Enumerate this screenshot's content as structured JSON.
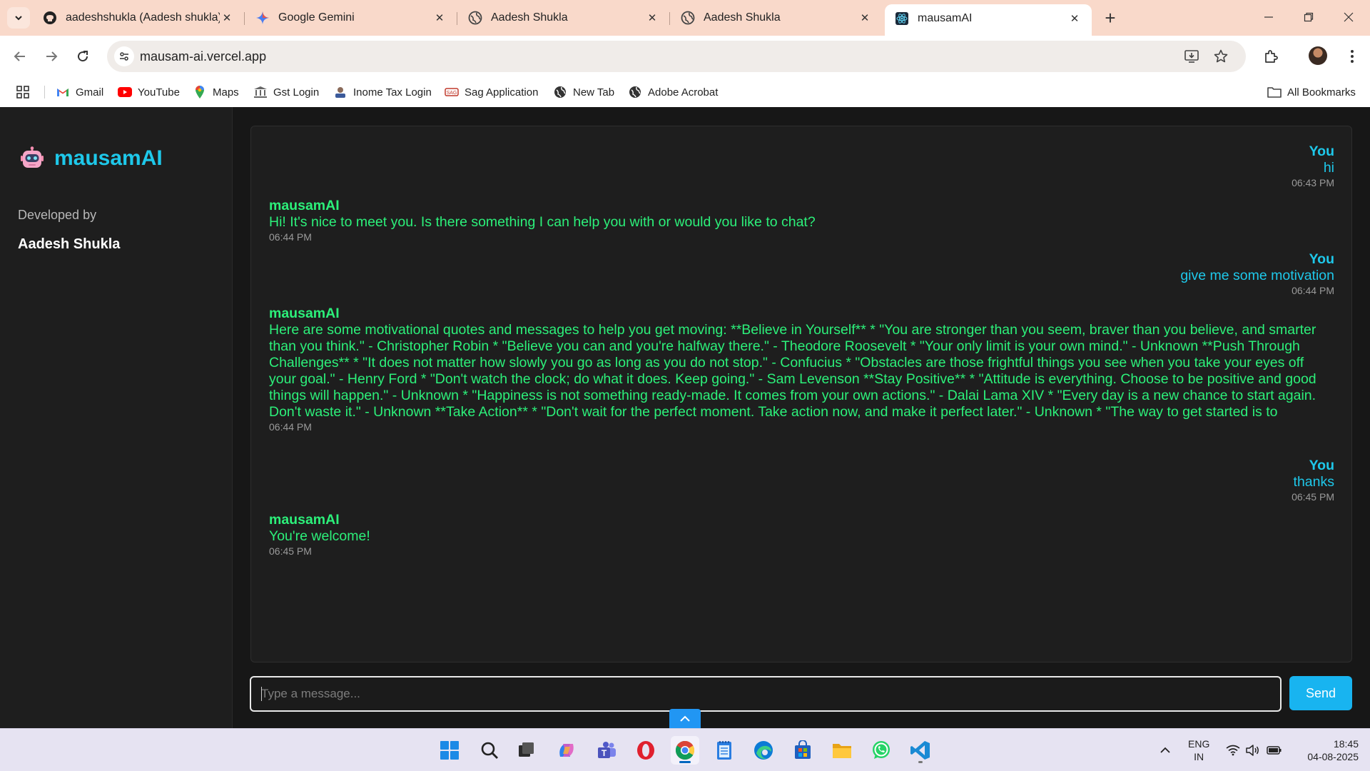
{
  "browser": {
    "tabs": [
      {
        "title": "aadeshshukla (Aadesh shukla)",
        "icon": "github-icon"
      },
      {
        "title": "Google Gemini",
        "icon": "gemini-icon"
      },
      {
        "title": "Aadesh Shukla",
        "icon": "globe-icon"
      },
      {
        "title": "Aadesh Shukla",
        "icon": "globe-icon"
      },
      {
        "title": "mausamAI",
        "icon": "react-icon",
        "active": true
      }
    ],
    "url": "mausam-ai.vercel.app",
    "bookmarks": [
      {
        "label": "Gmail",
        "icon": "gmail-icon"
      },
      {
        "label": "YouTube",
        "icon": "youtube-icon"
      },
      {
        "label": "Maps",
        "icon": "maps-icon"
      },
      {
        "label": "Gst Login",
        "icon": "gst-icon"
      },
      {
        "label": "Inome Tax Login",
        "icon": "income-tax-icon"
      },
      {
        "label": "Sag Application",
        "icon": "sag-icon"
      },
      {
        "label": "New Tab",
        "icon": "globe-icon"
      },
      {
        "label": "Adobe Acrobat",
        "icon": "globe-icon"
      }
    ],
    "all_bookmarks": "All Bookmarks"
  },
  "app": {
    "brand": "mausamAI",
    "developed_by": "Developed by",
    "developer": "Aadesh Shukla",
    "messages": [
      {
        "sender": "You",
        "text": "hi",
        "time": "06:43 PM"
      },
      {
        "sender": "mausamAI",
        "text": "Hi! It's nice to meet you. Is there something I can help you with or would you like to chat?",
        "time": "06:44 PM"
      },
      {
        "sender": "You",
        "text": "give me some motivation",
        "time": "06:44 PM"
      },
      {
        "sender": "mausamAI",
        "text": "Here are some motivational quotes and messages to help you get moving: **Believe in Yourself** * \"You are stronger than you seem, braver than you believe, and smarter than you think.\" - Christopher Robin * \"Believe you can and you're halfway there.\" - Theodore Roosevelt * \"Your only limit is your own mind.\" - Unknown **Push Through Challenges** * \"It does not matter how slowly you go as long as you do not stop.\" - Confucius * \"Obstacles are those frightful things you see when you take your eyes off your goal.\" - Henry Ford * \"Don't watch the clock; do what it does. Keep going.\" - Sam Levenson **Stay Positive** * \"Attitude is everything. Choose to be positive and good things will happen.\" - Unknown * \"Happiness is not something ready-made. It comes from your own actions.\" - Dalai Lama XIV * \"Every day is a new chance to start again. Don't waste it.\" - Unknown **Take Action** * \"Don't wait for the perfect moment. Take action now, and make it perfect later.\" - Unknown * \"The way to get started is to",
        "time": "06:44 PM"
      },
      {
        "sender": "You",
        "text": "thanks",
        "time": "06:45 PM"
      },
      {
        "sender": "mausamAI",
        "text": "You're welcome!",
        "time": "06:45 PM"
      }
    ],
    "input": {
      "placeholder": "Type a message...",
      "value": ""
    },
    "send_label": "Send"
  },
  "taskbar": {
    "lang": {
      "line1": "ENG",
      "line2": "IN"
    },
    "time": "18:45",
    "date": "04-08-2025"
  },
  "colors": {
    "user_text": "#1ec8ea",
    "bot_text": "#2cf07a",
    "send_button": "#18b4f0",
    "tab_strip": "#f9d9ca"
  }
}
